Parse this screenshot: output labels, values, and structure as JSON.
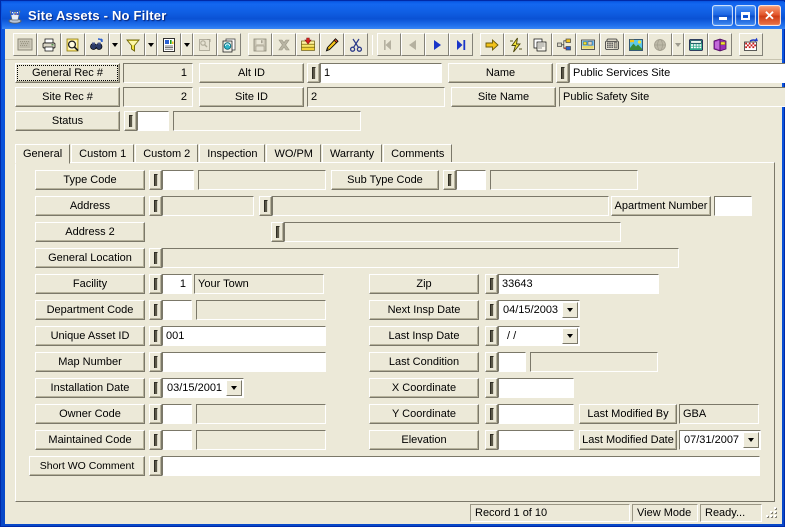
{
  "window": {
    "title": "Site Assets - No Filter",
    "icon": "app-icon",
    "minimize_label": "Minimize",
    "maximize_label": "Maximize",
    "close_label": "Close"
  },
  "toolbar": {
    "groups": [
      {
        "buttons": [
          {
            "name": "screen-icon",
            "label": "Screen",
            "enabled": false
          },
          {
            "name": "print-icon",
            "label": "Print",
            "enabled": true
          },
          {
            "name": "print-preview-icon",
            "label": "Print Preview",
            "enabled": true
          },
          {
            "name": "find-icon",
            "label": "Find",
            "enabled": true,
            "dropdown": true
          },
          {
            "name": "filter-icon",
            "label": "Filter",
            "enabled": true,
            "dropdown": true
          },
          {
            "name": "report-icon",
            "label": "Report",
            "enabled": true,
            "dropdown": true
          },
          {
            "name": "properties-icon",
            "label": "Properties",
            "enabled": false
          },
          {
            "name": "copy-record-icon",
            "label": "Copy Record",
            "enabled": true
          }
        ]
      },
      {
        "buttons": [
          {
            "name": "save-icon",
            "label": "Save",
            "enabled": false
          },
          {
            "name": "delete-icon",
            "label": "Delete",
            "enabled": false
          },
          {
            "name": "new-record-icon",
            "label": "New Record",
            "enabled": true
          },
          {
            "name": "edit-icon",
            "label": "Edit",
            "enabled": true
          },
          {
            "name": "cut-icon",
            "label": "Cut",
            "enabled": true
          }
        ]
      },
      {
        "buttons": [
          {
            "name": "first-record-icon",
            "label": "First Record",
            "enabled": false
          },
          {
            "name": "previous-record-icon",
            "label": "Previous Record",
            "enabled": false
          },
          {
            "name": "next-record-icon",
            "label": "Next Record",
            "enabled": true
          },
          {
            "name": "last-record-icon",
            "label": "Last Record",
            "enabled": true
          }
        ]
      },
      {
        "buttons": [
          {
            "name": "goto-icon",
            "label": "Go To",
            "enabled": true
          },
          {
            "name": "quick-action-icon",
            "label": "Quick Action",
            "enabled": true
          },
          {
            "name": "work-order-icon",
            "label": "Work Order",
            "enabled": true
          },
          {
            "name": "hierarchy-icon",
            "label": "Hierarchy",
            "enabled": true
          },
          {
            "name": "gis-map-icon",
            "label": "GIS Map",
            "enabled": true
          },
          {
            "name": "phone-icon",
            "label": "Phone",
            "enabled": true
          },
          {
            "name": "image-icon",
            "label": "Image",
            "enabled": true
          },
          {
            "name": "globe-icon",
            "label": "Web",
            "enabled": false,
            "dropdown": true
          },
          {
            "name": "calculator-icon",
            "label": "Calculator",
            "enabled": true
          },
          {
            "name": "help-book-icon",
            "label": "Help",
            "enabled": true,
            "dropdown": true
          }
        ]
      },
      {
        "buttons": [
          {
            "name": "exit-icon",
            "label": "Exit",
            "enabled": true
          }
        ]
      }
    ]
  },
  "header": {
    "general_rec_label": "General Rec #",
    "general_rec_value": "1",
    "alt_id_label": "Alt ID",
    "alt_id_value": "1",
    "name_label": "Name",
    "name_value": "Public Services Site",
    "site_rec_label": "Site Rec #",
    "site_rec_value": "2",
    "site_id_label": "Site ID",
    "site_id_value": "2",
    "site_name_label": "Site Name",
    "site_name_value": "Public Safety Site",
    "status_label": "Status",
    "status_code": "",
    "status_desc": ""
  },
  "tabs": [
    {
      "label": "General",
      "active": true
    },
    {
      "label": "Custom 1",
      "active": false
    },
    {
      "label": "Custom 2",
      "active": false
    },
    {
      "label": "Inspection",
      "active": false
    },
    {
      "label": "WO/PM",
      "active": false
    },
    {
      "label": "Warranty",
      "active": false
    },
    {
      "label": "Comments",
      "active": false
    }
  ],
  "general": {
    "type_code_label": "Type Code",
    "type_code_value": "",
    "type_code_desc": "",
    "sub_type_code_label": "Sub Type Code",
    "sub_type_code_value": "",
    "sub_type_code_desc": "",
    "address_label": "Address",
    "address_num": "",
    "address_street": "",
    "apartment_number_label": "Apartment Number",
    "apartment_number_value": "",
    "address2_label": "Address 2",
    "address2_value": "",
    "general_location_label": "General Location",
    "general_location_value": "",
    "facility_label": "Facility",
    "facility_code": "1",
    "facility_desc": "Your Town",
    "zip_label": "Zip",
    "zip_value": "33643",
    "department_code_label": "Department Code",
    "department_code_value": "",
    "department_code_desc": "",
    "next_insp_date_label": "Next Insp Date",
    "next_insp_date_value": "04/15/2003",
    "unique_asset_id_label": "Unique Asset ID",
    "unique_asset_id_value": "001",
    "last_insp_date_label": "Last Insp Date",
    "last_insp_date_value": "  /  /",
    "map_number_label": "Map Number",
    "map_number_value": "",
    "last_condition_label": "Last Condition",
    "last_condition_value": "",
    "last_condition_desc": "",
    "installation_date_label": "Installation Date",
    "installation_date_value": "03/15/2001",
    "x_coordinate_label": "X Coordinate",
    "x_coordinate_value": "",
    "owner_code_label": "Owner Code",
    "owner_code_value": "",
    "owner_code_desc": "",
    "y_coordinate_label": "Y Coordinate",
    "y_coordinate_value": "",
    "last_modified_by_label": "Last Modified By",
    "last_modified_by_value": "GBA",
    "maintained_code_label": "Maintained Code",
    "maintained_code_value": "",
    "maintained_code_desc": "",
    "elevation_label": "Elevation",
    "elevation_value": "",
    "last_modified_date_label": "Last Modified Date",
    "last_modified_date_value": "07/31/2007",
    "short_wo_comment_label": "Short WO Comment",
    "short_wo_comment_value": ""
  },
  "statusbar": {
    "record": "Record 1 of 10",
    "mode": "View Mode",
    "state": "Ready..."
  },
  "colors": {
    "title_blue": "#0a56e0",
    "face": "#ece9d8",
    "field_white": "#ffffff",
    "close_red": "#e2562c"
  }
}
